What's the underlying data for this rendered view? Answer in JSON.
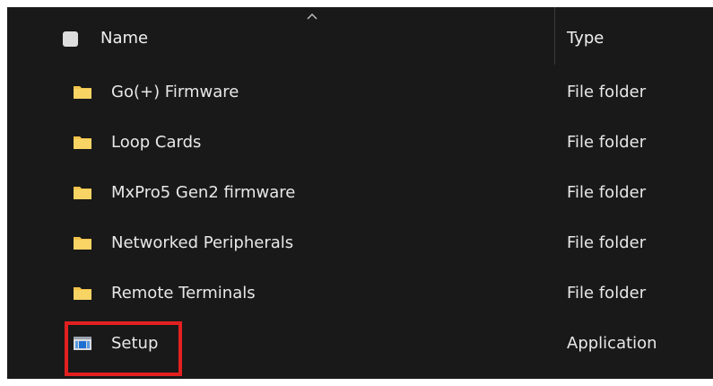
{
  "header": {
    "name_label": "Name",
    "type_label": "Type",
    "sort_icon": "chevron-up-icon"
  },
  "files": [
    {
      "name": "Go(+) Firmware",
      "type": "File folder",
      "icon": "folder-icon"
    },
    {
      "name": "Loop Cards",
      "type": "File folder",
      "icon": "folder-icon"
    },
    {
      "name": "MxPro5 Gen2 firmware",
      "type": "File folder",
      "icon": "folder-icon"
    },
    {
      "name": "Networked Peripherals",
      "type": "File folder",
      "icon": "folder-icon"
    },
    {
      "name": "Remote Terminals",
      "type": "File folder",
      "icon": "folder-icon"
    },
    {
      "name": "Setup",
      "type": "Application",
      "icon": "application-icon"
    }
  ],
  "colors": {
    "background": "#191919",
    "text": "#e8e8e8",
    "folder": "#f3c34a",
    "highlight": "#e32020"
  }
}
